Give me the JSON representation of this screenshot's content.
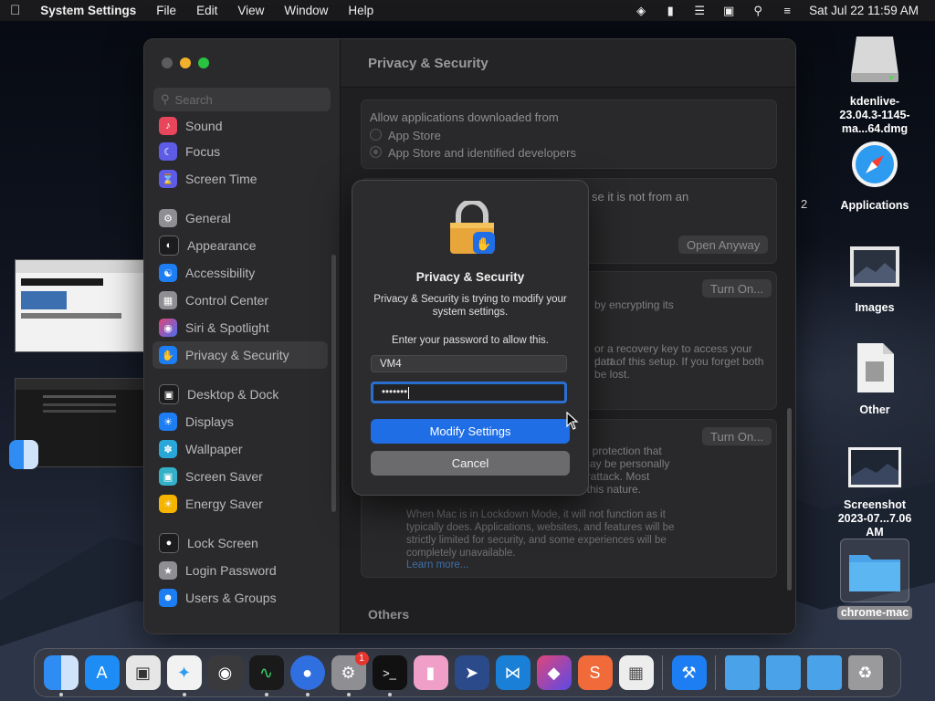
{
  "menubar": {
    "app": "System Settings",
    "items": [
      "File",
      "Edit",
      "View",
      "Window",
      "Help"
    ],
    "clock": "Sat Jul 22  11:59 AM"
  },
  "window": {
    "title": "Privacy & Security",
    "search_placeholder": "Search",
    "sidebar": [
      {
        "label": "Sound",
        "icon": "speaker-icon",
        "color": "#e8465a"
      },
      {
        "label": "Focus",
        "icon": "moon-icon",
        "color": "#5e5ce6"
      },
      {
        "label": "Screen Time",
        "icon": "hourglass-icon",
        "color": "#5e5ce6"
      },
      {
        "label": "General",
        "icon": "gear-icon",
        "color": "#8e8e93"
      },
      {
        "label": "Appearance",
        "icon": "appearance-icon",
        "color": "#1c1c1e"
      },
      {
        "label": "Accessibility",
        "icon": "accessibility-icon",
        "color": "#1d7ef3"
      },
      {
        "label": "Control Center",
        "icon": "control-center-icon",
        "color": "#8e8e93"
      },
      {
        "label": "Siri & Spotlight",
        "icon": "siri-icon",
        "color": "#b452c6"
      },
      {
        "label": "Privacy & Security",
        "icon": "hand-icon",
        "color": "#1d7ef3"
      },
      {
        "label": "Desktop & Dock",
        "icon": "dock-icon",
        "color": "#1c1c1e"
      },
      {
        "label": "Displays",
        "icon": "sun-icon",
        "color": "#1d7ef3"
      },
      {
        "label": "Wallpaper",
        "icon": "wallpaper-icon",
        "color": "#2aa7d9"
      },
      {
        "label": "Screen Saver",
        "icon": "screensaver-icon",
        "color": "#33b1c8"
      },
      {
        "label": "Energy Saver",
        "icon": "bulb-icon",
        "color": "#f5b400"
      },
      {
        "label": "Lock Screen",
        "icon": "lock-icon",
        "color": "#1c1c1e"
      },
      {
        "label": "Login Password",
        "icon": "key-icon",
        "color": "#8e8e93"
      },
      {
        "label": "Users & Groups",
        "icon": "users-icon",
        "color": "#1d7ef3"
      }
    ],
    "security": {
      "allow_label": "Allow applications downloaded from",
      "option_store": "App Store",
      "option_identified": "App Store and identified developers",
      "blocked_text": "se it is not from an",
      "open_anyway": "Open Anyway",
      "filevault_text": "by encrypting its",
      "turn_on_1": "Turn On...",
      "recovery_text_1": "or a recovery key to access your data.",
      "recovery_text_2": "part of this setup. If you forget both",
      "recovery_text_3": "be lost.",
      "turn_on_2": "Turn On...",
      "lockdown_1": "al protection that",
      "lockdown_2": "may be personally",
      "lockdown_3": "erattack. Most",
      "lockdown_4": "f this nature.",
      "lockdown_desc": "When Mac is in Lockdown Mode, it will not function as it typically does. Applications, websites, and features will be strictly limited for security, and some experiences will be completely unavailable.",
      "learn_more": "Learn more...",
      "others": "Others"
    }
  },
  "dialog": {
    "title": "Privacy & Security",
    "message": "Privacy & Security is trying to modify your system settings.",
    "prompt": "Enter your password to allow this.",
    "username": "VM4",
    "password_mask": "•••••••",
    "primary": "Modify Settings",
    "secondary": "Cancel"
  },
  "desktop": [
    {
      "label": "kdenlive-23.04.3-1145-ma...64.dmg",
      "icon": "disk-image-icon"
    },
    {
      "label": "Applications",
      "icon": "safari-icon"
    },
    {
      "label": "Images",
      "icon": "image-icon"
    },
    {
      "label": "Other",
      "icon": "document-icon"
    },
    {
      "label": "Screenshot 2023-07...7.06 AM",
      "icon": "screenshot-icon"
    },
    {
      "label": "chrome-mac",
      "icon": "folder-icon"
    }
  ],
  "peek_text": "2",
  "dock_badge": "1"
}
